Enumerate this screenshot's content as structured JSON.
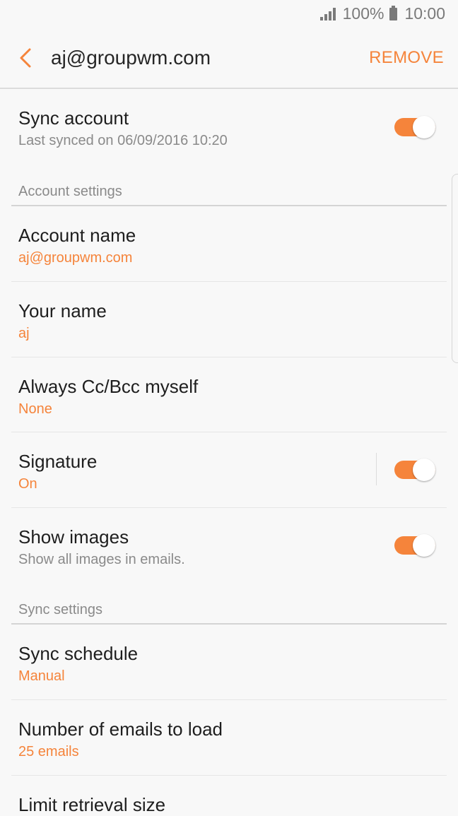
{
  "status_bar": {
    "battery": "100%",
    "time": "10:00",
    "icons": [
      "signal-icon",
      "battery-icon"
    ]
  },
  "app_bar": {
    "title": "aj@groupwm.com",
    "action": "REMOVE",
    "icon": "back-arrow-icon"
  },
  "colors": {
    "accent": "#f5843b",
    "background": "#f8f8f8",
    "text": "#1e1e1e",
    "secondary": "#8a8a8a"
  },
  "sync_account": {
    "title": "Sync account",
    "subtitle": "Last synced on 06/09/2016  10:20",
    "enabled": true
  },
  "account_settings": {
    "header": "Account settings",
    "items": [
      {
        "title": "Account name",
        "value": "aj@groupwm.com"
      },
      {
        "title": "Your name",
        "value": "aj"
      },
      {
        "title": "Always Cc/Bcc myself",
        "value": "None"
      },
      {
        "title": "Signature",
        "value": "On",
        "enabled": true
      },
      {
        "title": "Show images",
        "value": "Show all images in emails.",
        "enabled": true
      }
    ]
  },
  "sync_settings": {
    "header": "Sync settings",
    "items": [
      {
        "title": "Sync schedule",
        "value": "Manual"
      },
      {
        "title": "Number of emails to load",
        "value": "25 emails"
      },
      {
        "title": "Limit retrieval size"
      }
    ]
  }
}
